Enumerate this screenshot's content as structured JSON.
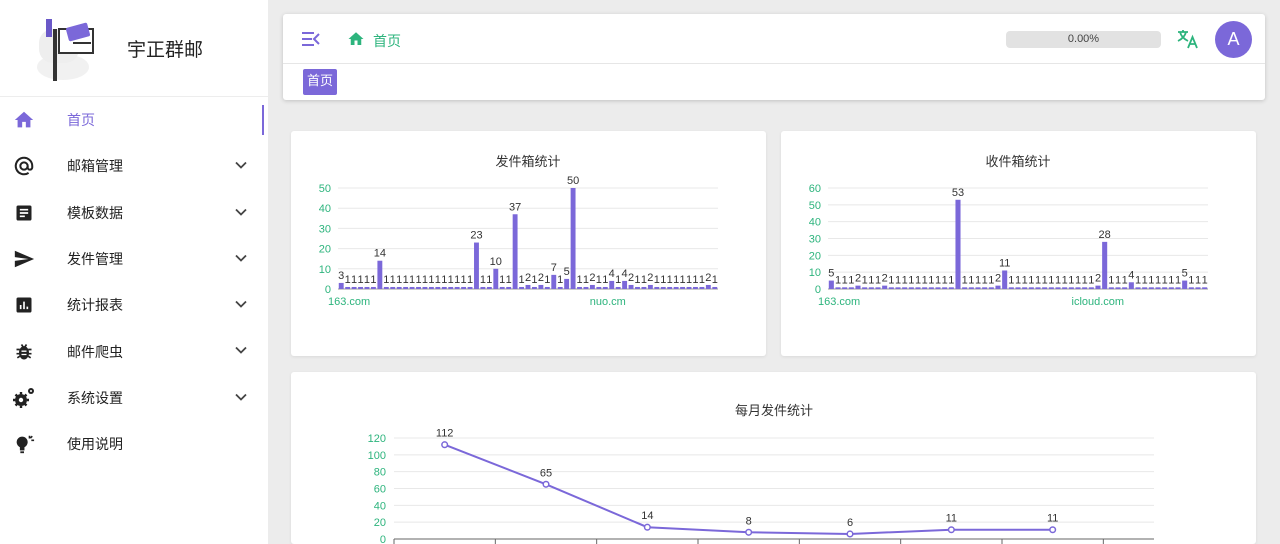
{
  "app": {
    "name": "宇正群邮"
  },
  "sidebar": {
    "items": [
      {
        "label": "首页",
        "icon": "home-icon",
        "active": true,
        "expandable": false
      },
      {
        "label": "邮箱管理",
        "icon": "at-icon",
        "expandable": true
      },
      {
        "label": "模板数据",
        "icon": "document-icon",
        "expandable": true
      },
      {
        "label": "发件管理",
        "icon": "send-icon",
        "expandable": true
      },
      {
        "label": "统计报表",
        "icon": "report-icon",
        "expandable": true
      },
      {
        "label": "邮件爬虫",
        "icon": "bug-icon",
        "expandable": true
      },
      {
        "label": "系统设置",
        "icon": "gears-icon",
        "expandable": true
      },
      {
        "label": "使用说明",
        "icon": "lightbulb-icon",
        "expandable": false
      }
    ]
  },
  "header": {
    "breadcrumb": "首页",
    "progress_text": "0.00%",
    "progress_value": 0,
    "avatar_letter": "A",
    "tab_label": "首页"
  },
  "colors": {
    "accent": "#7b68d9",
    "green": "#2db47d"
  },
  "chart_data": [
    {
      "type": "bar",
      "title": "发件箱统计",
      "ylim": [
        0,
        50
      ],
      "yticks": [
        0,
        10,
        20,
        30,
        40,
        50
      ],
      "xlabels": [
        "163.com",
        "nuo.cm"
      ],
      "values": [
        3,
        1,
        1,
        1,
        1,
        1,
        14,
        1,
        1,
        1,
        1,
        1,
        1,
        1,
        1,
        1,
        1,
        1,
        1,
        1,
        1,
        23,
        1,
        1,
        10,
        1,
        1,
        37,
        1,
        2,
        1,
        2,
        1,
        7,
        1,
        5,
        50,
        1,
        1,
        2,
        1,
        1,
        4,
        1,
        4,
        2,
        1,
        1,
        2,
        1,
        1,
        1,
        1,
        1,
        1,
        1,
        1,
        2,
        1
      ]
    },
    {
      "type": "bar",
      "title": "收件箱统计",
      "ylim": [
        0,
        60
      ],
      "yticks": [
        0,
        10,
        20,
        30,
        40,
        50,
        60
      ],
      "xlabels": [
        "163.com",
        "icloud.com"
      ],
      "values": [
        5,
        1,
        1,
        1,
        2,
        1,
        1,
        1,
        2,
        1,
        1,
        1,
        1,
        1,
        1,
        1,
        1,
        1,
        1,
        53,
        1,
        1,
        1,
        1,
        1,
        2,
        11,
        1,
        1,
        1,
        1,
        1,
        1,
        1,
        1,
        1,
        1,
        1,
        1,
        1,
        2,
        28,
        1,
        1,
        1,
        4,
        1,
        1,
        1,
        1,
        1,
        1,
        1,
        5,
        1,
        1,
        1
      ]
    },
    {
      "type": "line",
      "title": "每月发件统计",
      "ylim": [
        0,
        120
      ],
      "yticks": [
        0,
        20,
        40,
        60,
        80,
        100,
        120
      ],
      "values": [
        112,
        65,
        14,
        8,
        6,
        11,
        11
      ]
    }
  ]
}
